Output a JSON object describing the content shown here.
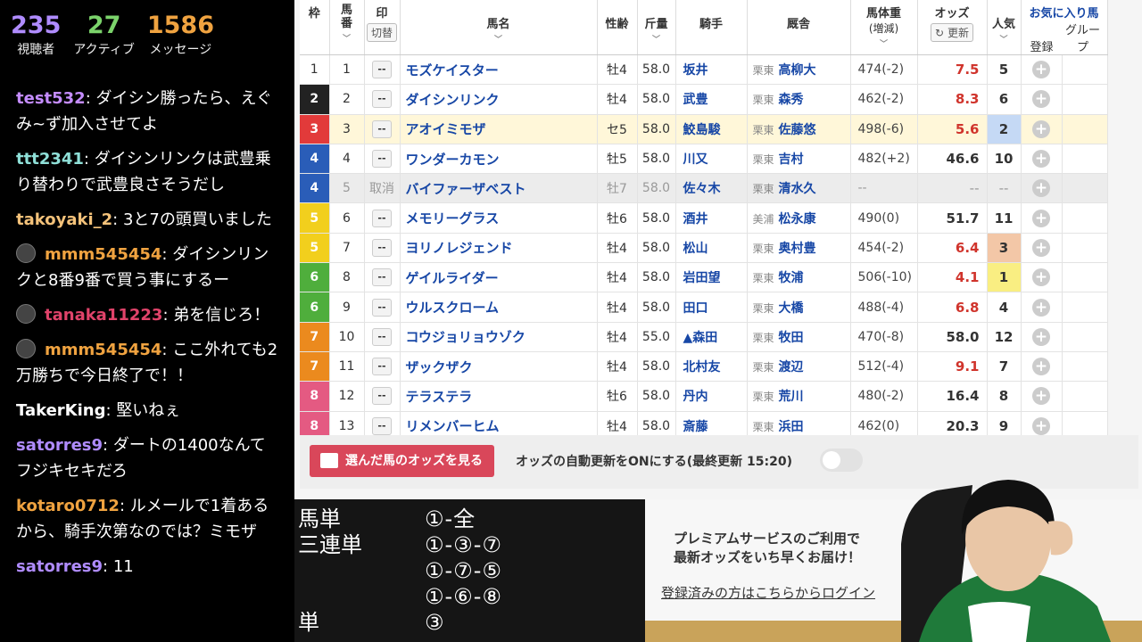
{
  "stats": [
    {
      "value": "235",
      "label": "視聴者",
      "color": "#b08cff"
    },
    {
      "value": "27",
      "label": "アクティブ",
      "color": "#7bd36b"
    },
    {
      "value": "1586",
      "label": "メッセージ",
      "color": "#f0a340"
    }
  ],
  "messages": [
    {
      "user": "test532",
      "color": "#c48cff",
      "text": "ダイシン勝ったら、えぐみ~ず加入させてよ",
      "avatar": false
    },
    {
      "user": "ttt2341",
      "color": "#8fe0d8",
      "text": "ダイシンリンクは武豊乗り替わりで武豊良さそうだし",
      "avatar": false
    },
    {
      "user": "takoyaki_2",
      "color": "#f4c27a",
      "text": "3と7の頭買いました",
      "avatar": false
    },
    {
      "user": "mmm545454",
      "color": "#f0a340",
      "text": "ダイシンリンクと8番9番で買う事にするー",
      "avatar": true
    },
    {
      "user": "tanaka11223",
      "color": "#e0436a",
      "text": "弟を信じろ！",
      "avatar": true
    },
    {
      "user": "mmm545454",
      "color": "#f0a340",
      "text": "ここ外れても2万勝ちで今日終了で！！",
      "avatar": true
    },
    {
      "user": "TakerKing",
      "color": "#ffffff",
      "text": "堅いねぇ",
      "avatar": false
    },
    {
      "user": "satorres9",
      "color": "#b08cff",
      "text": "ダートの1400なんてフジキセキだろ",
      "avatar": false
    },
    {
      "user": "kotaro0712",
      "color": "#f0a340",
      "text": "ルメールで1着あるから、騎手次第なのでは？ミモザ",
      "avatar": false
    },
    {
      "user": "satorres9",
      "color": "#b08cff",
      "text": "11",
      "avatar": false
    }
  ],
  "table": {
    "headers": {
      "waku": "枠",
      "umaban": "馬番",
      "mark": "印",
      "mark_toggle": "切替",
      "name": "馬名",
      "sexage": "性齢",
      "kinryo": "斤量",
      "jockey": "騎手",
      "stable": "厩舎",
      "weight": "馬体重",
      "weight_sub": "(増減)",
      "odds": "オッズ",
      "refresh": "更新",
      "pop": "人気",
      "fav": "お気に入り馬",
      "register": "登録",
      "group": "グループ"
    },
    "rows": [
      {
        "waku": "1",
        "wcolor": "#ffffff",
        "wtext": "#333333",
        "no": "1",
        "mark": "--",
        "name": "モズケイスター",
        "sex": "牡4",
        "kin": "58.0",
        "jockey": "坂井",
        "loc": "栗東",
        "trainer": "高柳大",
        "weight": "474(-2)",
        "odds": "7.5",
        "ocolor": "#d0342c",
        "pop": "5",
        "pbg": ""
      },
      {
        "waku": "2",
        "wcolor": "#222222",
        "wtext": "#ffffff",
        "no": "2",
        "mark": "--",
        "name": "ダイシンリンク",
        "sex": "牡4",
        "kin": "58.0",
        "jockey": "武豊",
        "loc": "栗東",
        "trainer": "森秀",
        "weight": "462(-2)",
        "odds": "8.3",
        "ocolor": "#d0342c",
        "pop": "6",
        "pbg": ""
      },
      {
        "waku": "3",
        "wcolor": "#e23a3a",
        "wtext": "#ffffff",
        "no": "3",
        "mark": "--",
        "name": "アオイミモザ",
        "sex": "セ5",
        "kin": "58.0",
        "jockey": "鮫島駿",
        "loc": "栗東",
        "trainer": "佐藤悠",
        "weight": "498(-6)",
        "odds": "5.6",
        "ocolor": "#d0342c",
        "pop": "2",
        "pbg": "#c5d9f5",
        "hl": true
      },
      {
        "waku": "4",
        "wcolor": "#2a5db8",
        "wtext": "#ffffff",
        "no": "4",
        "mark": "--",
        "name": "ワンダーカモン",
        "sex": "牡5",
        "kin": "58.0",
        "jockey": "川又",
        "loc": "栗東",
        "trainer": "吉村",
        "weight": "482(+2)",
        "odds": "46.6",
        "ocolor": "#333333",
        "pop": "10",
        "pbg": ""
      },
      {
        "waku": "4",
        "wcolor": "#2a5db8",
        "wtext": "#ffffff",
        "no": "5",
        "mark": "取消",
        "name": "バイファーザベスト",
        "sex": "牡7",
        "kin": "58.0",
        "jockey": "佐々木",
        "loc": "栗東",
        "trainer": "清水久",
        "weight": "--",
        "odds": "--",
        "ocolor": "#999999",
        "pop": "--",
        "pbg": "",
        "scratch": true
      },
      {
        "waku": "5",
        "wcolor": "#f2cf1d",
        "wtext": "#ffffff",
        "no": "6",
        "mark": "--",
        "name": "メモリーグラス",
        "sex": "牡6",
        "kin": "58.0",
        "jockey": "酒井",
        "loc": "美浦",
        "trainer": "松永康",
        "weight": "490(0)",
        "odds": "51.7",
        "ocolor": "#333333",
        "pop": "11",
        "pbg": ""
      },
      {
        "waku": "5",
        "wcolor": "#f2cf1d",
        "wtext": "#ffffff",
        "no": "7",
        "mark": "--",
        "name": "ヨリノレジェンド",
        "sex": "牡4",
        "kin": "58.0",
        "jockey": "松山",
        "loc": "栗東",
        "trainer": "奥村豊",
        "weight": "454(-2)",
        "odds": "6.4",
        "ocolor": "#d0342c",
        "pop": "3",
        "pbg": "#f3c7a7"
      },
      {
        "waku": "6",
        "wcolor": "#4fae3c",
        "wtext": "#ffffff",
        "no": "8",
        "mark": "--",
        "name": "ゲイルライダー",
        "sex": "牡4",
        "kin": "58.0",
        "jockey": "岩田望",
        "loc": "栗東",
        "trainer": "牧浦",
        "weight": "506(-10)",
        "odds": "4.1",
        "ocolor": "#d0342c",
        "pop": "1",
        "pbg": "#f9ee82"
      },
      {
        "waku": "6",
        "wcolor": "#4fae3c",
        "wtext": "#ffffff",
        "no": "9",
        "mark": "--",
        "name": "ウルスクローム",
        "sex": "牡4",
        "kin": "58.0",
        "jockey": "田口",
        "loc": "栗東",
        "trainer": "大橋",
        "weight": "488(-4)",
        "odds": "6.8",
        "ocolor": "#d0342c",
        "pop": "4",
        "pbg": ""
      },
      {
        "waku": "7",
        "wcolor": "#eb8a1e",
        "wtext": "#ffffff",
        "no": "10",
        "mark": "--",
        "name": "コウジョリョウゾク",
        "sex": "牡4",
        "kin": "55.0",
        "jockey": "▲森田",
        "loc": "栗東",
        "trainer": "牧田",
        "weight": "470(-8)",
        "odds": "58.0",
        "ocolor": "#333333",
        "pop": "12",
        "pbg": ""
      },
      {
        "waku": "7",
        "wcolor": "#eb8a1e",
        "wtext": "#ffffff",
        "no": "11",
        "mark": "--",
        "name": "ザックザク",
        "sex": "牡4",
        "kin": "58.0",
        "jockey": "北村友",
        "loc": "栗東",
        "trainer": "渡辺",
        "weight": "512(-4)",
        "odds": "9.1",
        "ocolor": "#d0342c",
        "pop": "7",
        "pbg": ""
      },
      {
        "waku": "8",
        "wcolor": "#e45a82",
        "wtext": "#ffffff",
        "no": "12",
        "mark": "--",
        "name": "テラステラ",
        "sex": "牡6",
        "kin": "58.0",
        "jockey": "丹内",
        "loc": "栗東",
        "trainer": "荒川",
        "weight": "480(-2)",
        "odds": "16.4",
        "ocolor": "#333333",
        "pop": "8",
        "pbg": ""
      },
      {
        "waku": "8",
        "wcolor": "#e45a82",
        "wtext": "#ffffff",
        "no": "13",
        "mark": "--",
        "name": "リメンバーヒム",
        "sex": "牡4",
        "kin": "58.0",
        "jockey": "斎藤",
        "loc": "栗東",
        "trainer": "浜田",
        "weight": "462(0)",
        "odds": "20.3",
        "ocolor": "#333333",
        "pop": "9",
        "pbg": ""
      }
    ]
  },
  "footer": {
    "view_odds_label": "選んだ馬のオッズを見る",
    "auto_update_text": "オッズの自動更新をONにする(最終更新 15:20)"
  },
  "bets": [
    {
      "type": "馬単",
      "combo": "①-全"
    },
    {
      "type": "三連単",
      "combo": "①-③-⑦"
    },
    {
      "type": "",
      "combo": "①-⑦-⑤"
    },
    {
      "type": "",
      "combo": "①-⑥-⑧"
    },
    {
      "type": "単",
      "combo": "③"
    }
  ],
  "premium": {
    "line1": "プレミアムサービスのご利用で",
    "line2": "最新オッズをいち早くお届け！",
    "login": "登録済みの方はこちらからログイン"
  }
}
